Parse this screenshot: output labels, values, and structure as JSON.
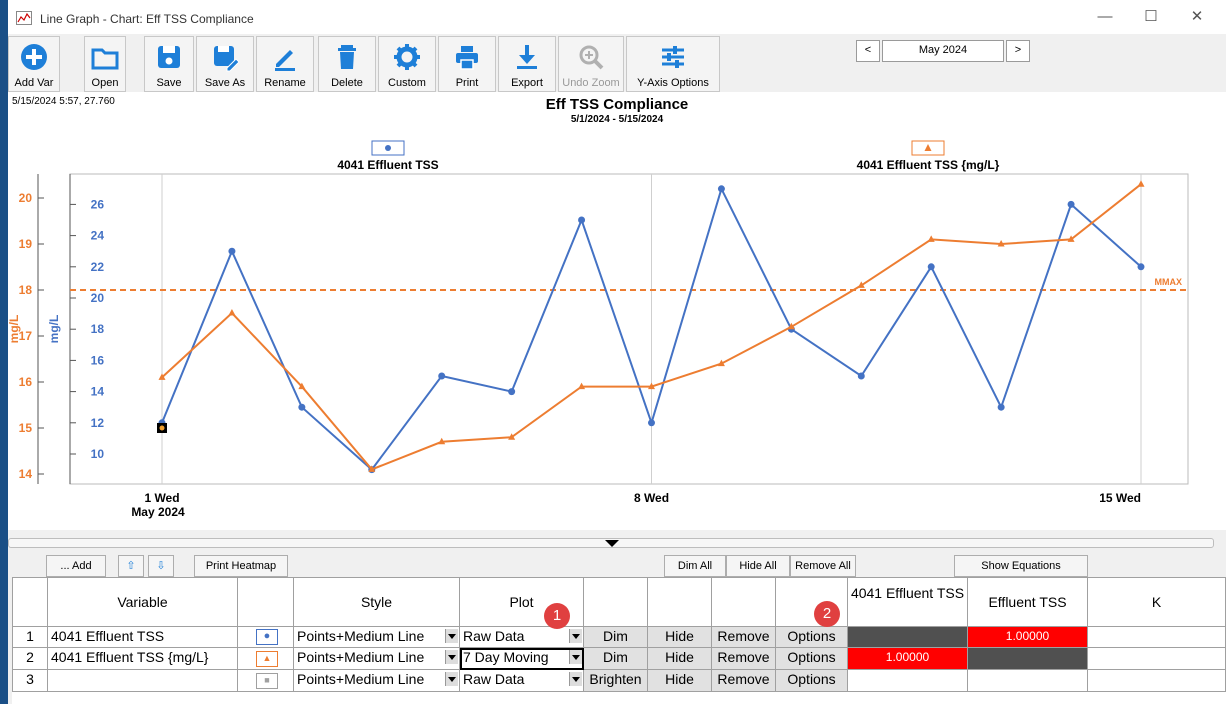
{
  "window": {
    "title": "Line Graph - Chart: Eff TSS Compliance"
  },
  "toolbar": [
    {
      "label": "Add Var",
      "icon": "plus-circle-icon"
    },
    {
      "label": "Open",
      "icon": "folder-icon"
    },
    {
      "label": "Save",
      "icon": "save-icon"
    },
    {
      "label": "Save As",
      "icon": "save-as-icon"
    },
    {
      "label": "Rename",
      "icon": "pencil-icon"
    },
    {
      "label": "Delete",
      "icon": "trash-icon"
    },
    {
      "label": "Custom",
      "icon": "gear-icon"
    },
    {
      "label": "Print",
      "icon": "printer-icon"
    },
    {
      "label": "Export",
      "icon": "download-icon"
    },
    {
      "label": "Undo Zoom",
      "icon": "zoom-icon",
      "disabled": true
    },
    {
      "label": "Y-Axis Options",
      "icon": "sliders-icon"
    }
  ],
  "month_nav": {
    "prev": "<",
    "month": "May 2024",
    "next": ">"
  },
  "cursor_readout": "5/15/2024 5:57, 27.760",
  "chart_data": {
    "type": "line",
    "title": "Eff TSS Compliance",
    "subtitle": "5/1/2024 - 5/15/2024",
    "x": [
      1,
      2,
      3,
      4,
      5,
      6,
      7,
      8,
      9,
      10,
      11,
      12,
      13,
      14,
      15
    ],
    "x_tick_labels": [
      "1 Wed",
      "8 Wed",
      "15 Wed"
    ],
    "x_sublabel": "May 2024",
    "series": [
      {
        "name": "4041  Effluent TSS",
        "axis": "right",
        "color": "#4472c4",
        "marker": "circle",
        "values": [
          12,
          23,
          13,
          9,
          15,
          14,
          25,
          12,
          27,
          18,
          15,
          22,
          13,
          26,
          22
        ]
      },
      {
        "name": "4041  Effluent TSS {mg/L}",
        "axis": "left",
        "color": "#ed7d31",
        "marker": "triangle",
        "values": [
          16.1,
          17.5,
          15.9,
          14.1,
          14.7,
          14.8,
          15.9,
          15.9,
          16.4,
          17.2,
          18.1,
          19.1,
          19.0,
          19.1,
          20.3
        ]
      }
    ],
    "y_left": {
      "label": "mg/L",
      "color": "#ed7d31",
      "ticks": [
        14,
        15,
        16,
        17,
        18,
        19,
        20
      ],
      "range": [
        13.6,
        20.6
      ]
    },
    "y_right": {
      "label": "mg/L",
      "color": "#4472c4",
      "ticks": [
        10,
        12,
        14,
        16,
        18,
        20,
        22,
        24,
        26
      ],
      "range": [
        8,
        27.5
      ]
    },
    "reference_line": {
      "label": "MMAX",
      "value": 18,
      "axis": "left",
      "color": "#ed7d31"
    },
    "cursor_point": {
      "x": 1,
      "y": 15,
      "axis": "left"
    }
  },
  "grid_buttons": {
    "add": "... Add",
    "up": "⇧",
    "down": "⇩",
    "print_heatmap": "Print Heatmap",
    "dim_all": "Dim All",
    "hide_all": "Hide All",
    "remove_all": "Remove All",
    "show_equations": "Show Equations"
  },
  "table": {
    "headers": {
      "variable": "Variable",
      "style": "Style",
      "plot": "Plot",
      "col_a": "4041  Effluent TSS",
      "col_b": "Effluent TSS",
      "col_c": "K"
    },
    "badges": [
      "1",
      "2"
    ],
    "rows": [
      {
        "num": "1",
        "variable": "4041  Effluent TSS",
        "marker": "●",
        "marker_color": "#4472c4",
        "style": "Points+Medium Line",
        "plot": "Raw Data",
        "dim": "Dim",
        "hide": "Hide",
        "remove": "Remove",
        "options": "Options",
        "col_a": "",
        "col_b": "1.00000"
      },
      {
        "num": "2",
        "variable": "4041  Effluent TSS {mg/L}",
        "marker": "▲",
        "marker_color": "#ed7d31",
        "style": "Points+Medium Line",
        "plot": "7 Day Moving",
        "dim": "Dim",
        "hide": "Hide",
        "remove": "Remove",
        "options": "Options",
        "col_a": "1.00000",
        "col_b": ""
      },
      {
        "num": "3",
        "variable": "",
        "marker": "■",
        "marker_color": "#a0a0a0",
        "style": "Points+Medium Line",
        "plot": "Raw Data",
        "dim": "Brighten",
        "hide": "Hide",
        "remove": "Remove",
        "options": "Options",
        "col_a": "",
        "col_b": ""
      }
    ]
  }
}
